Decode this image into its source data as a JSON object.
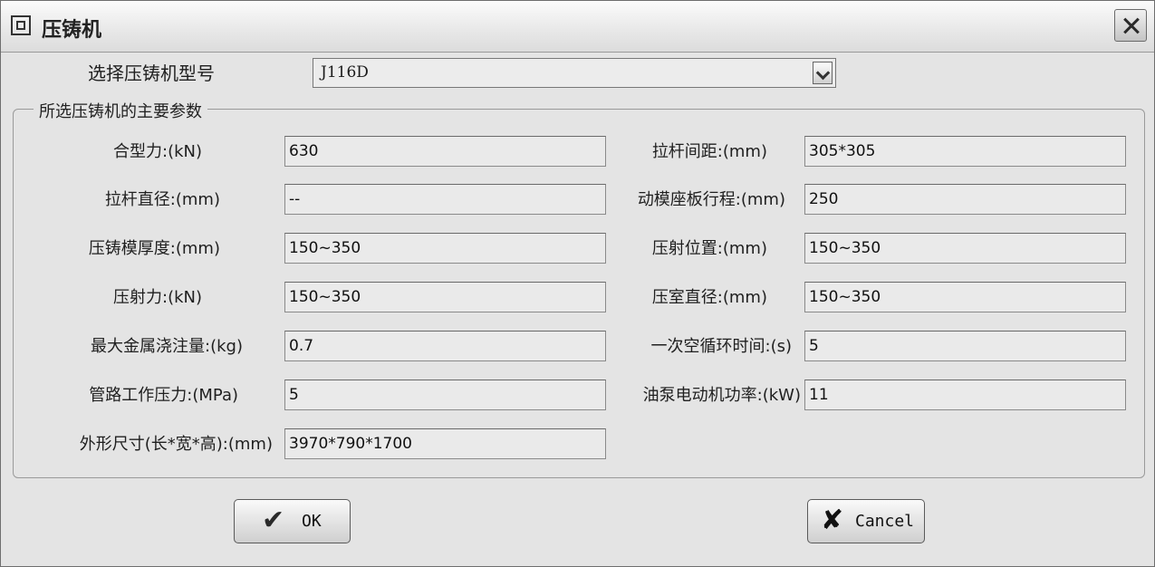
{
  "window": {
    "title": "压铸机"
  },
  "selector": {
    "label": "选择压铸机型号",
    "value": "J116D"
  },
  "group": {
    "title": "所选压铸机的主要参数"
  },
  "params_left": [
    {
      "label": "合型力:(kN)",
      "value": "630"
    },
    {
      "label": "拉杆直径:(mm)",
      "value": "--"
    },
    {
      "label": "压铸模厚度:(mm)",
      "value": "150~350"
    },
    {
      "label": "压射力:(kN)",
      "value": "150~350"
    },
    {
      "label": "最大金属浇注量:(kg)",
      "value": "0.7"
    },
    {
      "label": "管路工作压力:(MPa)",
      "value": "5"
    },
    {
      "label": "外形尺寸(长*宽*高):(mm)",
      "value": "3970*790*1700"
    }
  ],
  "params_right": [
    {
      "label": "拉杆间距:(mm)",
      "value": "305*305"
    },
    {
      "label": "动模座板行程:(mm)",
      "value": "250"
    },
    {
      "label": "压射位置:(mm)",
      "value": "150~350"
    },
    {
      "label": "压室直径:(mm)",
      "value": "150~350"
    },
    {
      "label": "一次空循环时间:(s)",
      "value": "5"
    },
    {
      "label": "油泵电动机功率:(kW)",
      "value": "11"
    }
  ],
  "buttons": {
    "ok": {
      "label": "OK",
      "icon": "check-icon"
    },
    "cancel": {
      "label": "Cancel",
      "icon": "x-icon"
    }
  }
}
